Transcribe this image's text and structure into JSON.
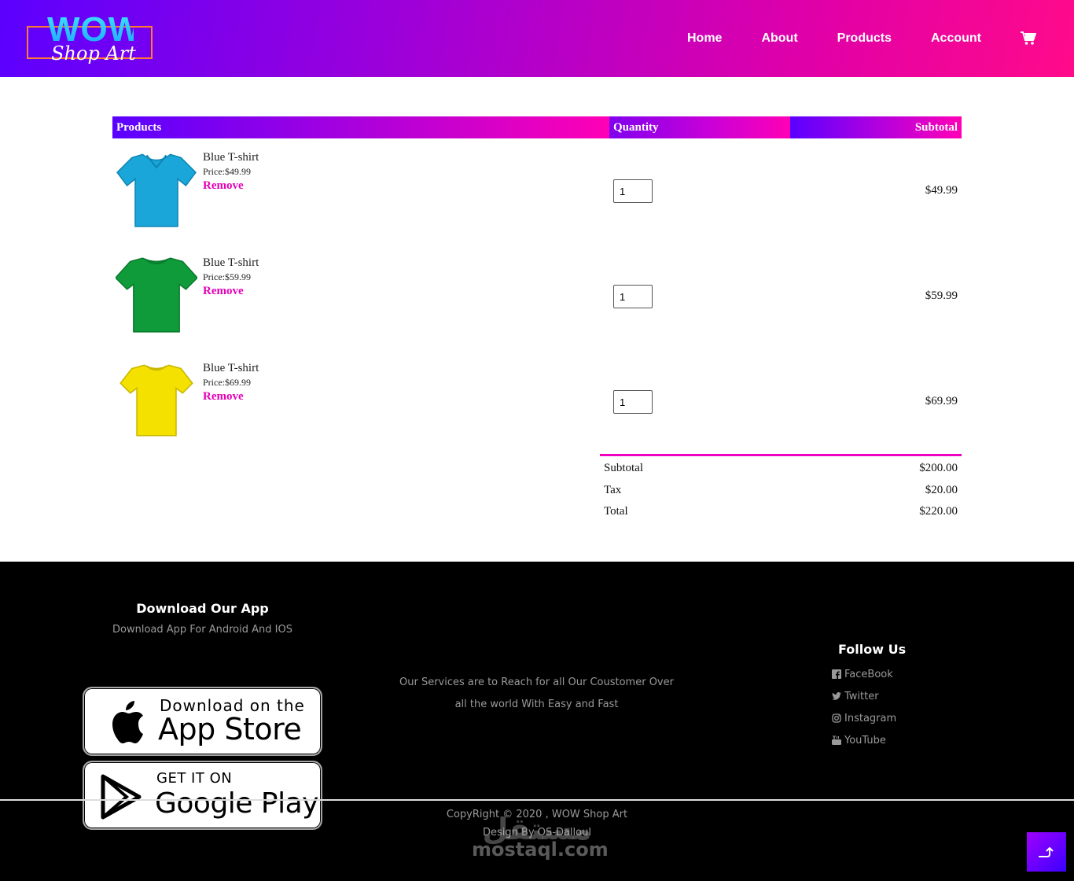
{
  "colors": {
    "accent_pink": "#e500b6",
    "accent_purple": "#5b00ff",
    "footer_bg": "#000000"
  },
  "brand": {
    "wordmark": "WOW",
    "script": "Shop Art"
  },
  "nav": {
    "items": [
      "Home",
      "About",
      "Products",
      "Account"
    ],
    "cart_icon": "cart-icon"
  },
  "table": {
    "headers": {
      "products": "Products",
      "quantity": "Quantity",
      "subtotal": "Subtotal"
    },
    "rows": [
      {
        "name": "Blue T-shirt",
        "price": "Price:$49.99",
        "remove": "Remove",
        "qty": "1",
        "subtotal": "$49.99",
        "shirt_color": "#1aa6d9"
      },
      {
        "name": "Blue T-shirt",
        "price": "Price:$59.99",
        "remove": "Remove",
        "qty": "1",
        "subtotal": "$59.99",
        "shirt_color": "#0f9b3a"
      },
      {
        "name": "Blue T-shirt",
        "price": "Price:$69.99",
        "remove": "Remove",
        "qty": "1",
        "subtotal": "$69.99",
        "shirt_color": "#f5e100"
      }
    ]
  },
  "totals": [
    {
      "label": "Subtotal",
      "value": "$200.00"
    },
    {
      "label": "Tax",
      "value": "$20.00"
    },
    {
      "label": "Total",
      "value": "$220.00"
    }
  ],
  "footer": {
    "app_title": "Download Our App",
    "app_subtitle": "Download App For Android And IOS",
    "app_store": {
      "small": "Download on the",
      "big": "App Store"
    },
    "google_play": {
      "small": "GET IT ON",
      "big": "Google Play"
    },
    "services_line1": "Our Services are to Reach for all Our Coustomer Over",
    "services_line2": "all the world With Easy and Fast",
    "follow_title": "Follow Us",
    "social": [
      {
        "label": "FaceBook",
        "icon": "facebook-icon"
      },
      {
        "label": "Twitter",
        "icon": "twitter-icon"
      },
      {
        "label": "Instagram",
        "icon": "instagram-icon"
      },
      {
        "label": "YouTube",
        "icon": "youtube-icon"
      }
    ],
    "copyright": "CopyRight © 2020 , WOW Shop Art",
    "design_by": "Design By OS-Dalloul",
    "watermark_ar": "مستقل",
    "watermark": "mostaql.com"
  }
}
